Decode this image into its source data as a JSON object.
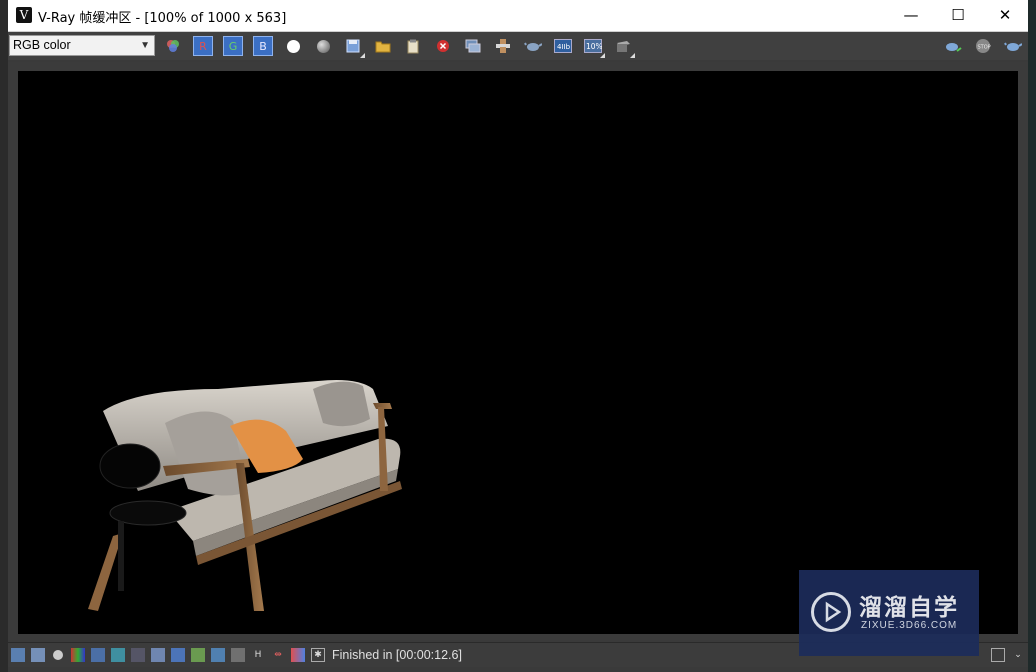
{
  "window": {
    "title": "V-Ray 帧缓冲区 - [100% of 1000 x 563]",
    "app_icon_glyph": "V",
    "controls": {
      "minimize": "—",
      "maximize": "☐",
      "close": "✕"
    }
  },
  "toolbar": {
    "channel_select": "RGB color",
    "channel_buttons": [
      "R",
      "G",
      "B"
    ],
    "accent_color": "#3b6fc4",
    "icons": [
      "color-palette-icon",
      "red-channel-button",
      "green-channel-button",
      "blue-channel-button",
      "white-circle-icon",
      "mono-circle-icon",
      "save-icon",
      "open-folder-icon",
      "clipboard-icon",
      "clear-stop-icon",
      "track-mouse-icon",
      "region-render-icon",
      "teapot-icon",
      "lut-icon",
      "zoom-percent-icon",
      "pixel-info-icon",
      "render-teapot-icon",
      "stop-render-icon",
      "render-last-icon"
    ],
    "zoom_badge": "10%"
  },
  "status": {
    "text": "Finished in [00:00:12.6]"
  },
  "watermark": {
    "chinese": "溜溜自学",
    "url": "ZIXUE.3D66.COM"
  }
}
